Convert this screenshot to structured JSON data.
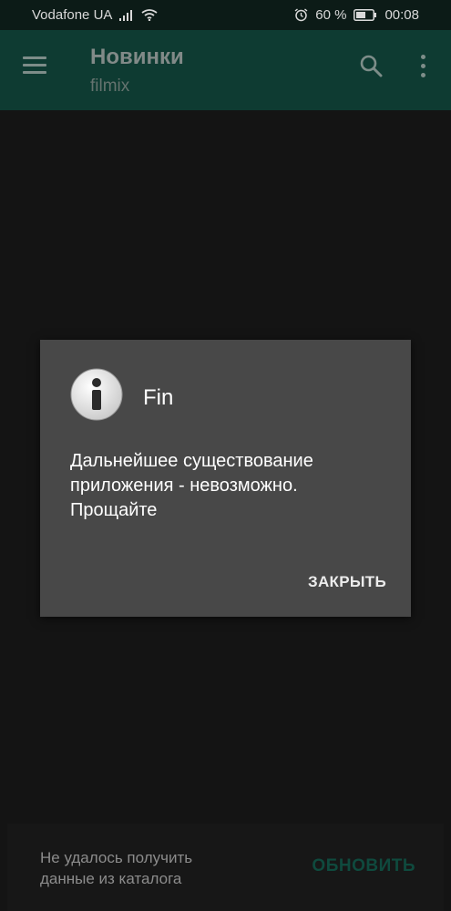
{
  "status_bar": {
    "carrier": "Vodafone UA",
    "battery_percent": "60 %",
    "time": "00:08"
  },
  "toolbar": {
    "title": "Новинки",
    "subtitle": "filmix"
  },
  "dialog": {
    "title": "Fin",
    "message": "Дальнейшее существование\nприложения - невозможно.\nПрощайте",
    "button": "ЗАКРЫТЬ"
  },
  "snackbar": {
    "message": "Не удалось получить\nданные из каталога",
    "action": "ОБНОВИТЬ",
    "action_color": "#0f4a3e"
  },
  "icons": [
    "signal-icon",
    "wifi-icon",
    "alarm-icon",
    "battery-icon",
    "menu-icon",
    "search-icon",
    "more-icon",
    "info-icon"
  ]
}
